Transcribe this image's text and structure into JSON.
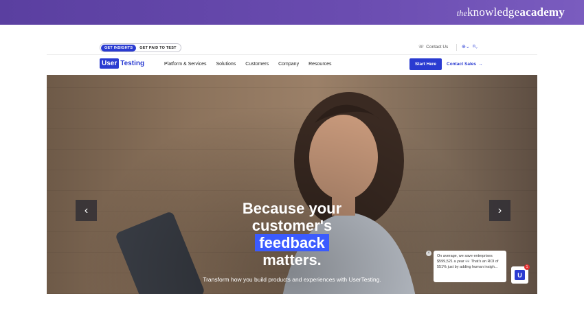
{
  "site_brand": {
    "prefix": "the",
    "name": "knowledge",
    "suffix": "academy"
  },
  "utility_bar": {
    "toggle": [
      "GET INSIGHTS",
      "GET PAID TO TEST"
    ],
    "contact": "Contact Us"
  },
  "nav": {
    "logo_box": "User",
    "logo_text": "Testing",
    "items": [
      "Platform & Services",
      "Solutions",
      "Customers",
      "Company",
      "Resources"
    ],
    "cta_primary": "Start Here",
    "cta_secondary": "Contact Sales"
  },
  "hero": {
    "line1": "Because your",
    "line2": "customer's",
    "highlight": "feedback",
    "line4": "matters.",
    "subtitle": "Transform how you build products and experiences with UserTesting.",
    "prev_arrow": "‹",
    "next_arrow": "›"
  },
  "chat": {
    "message": "On average, we save enterprises $599,521 a year 👀 That's an ROI of 551% just by adding human insigh...",
    "badge": "1",
    "widget_letter": "U"
  },
  "colors": {
    "accent": "#2a3bd1",
    "highlight": "#3b5bff",
    "banner": "#5a3fa0"
  }
}
